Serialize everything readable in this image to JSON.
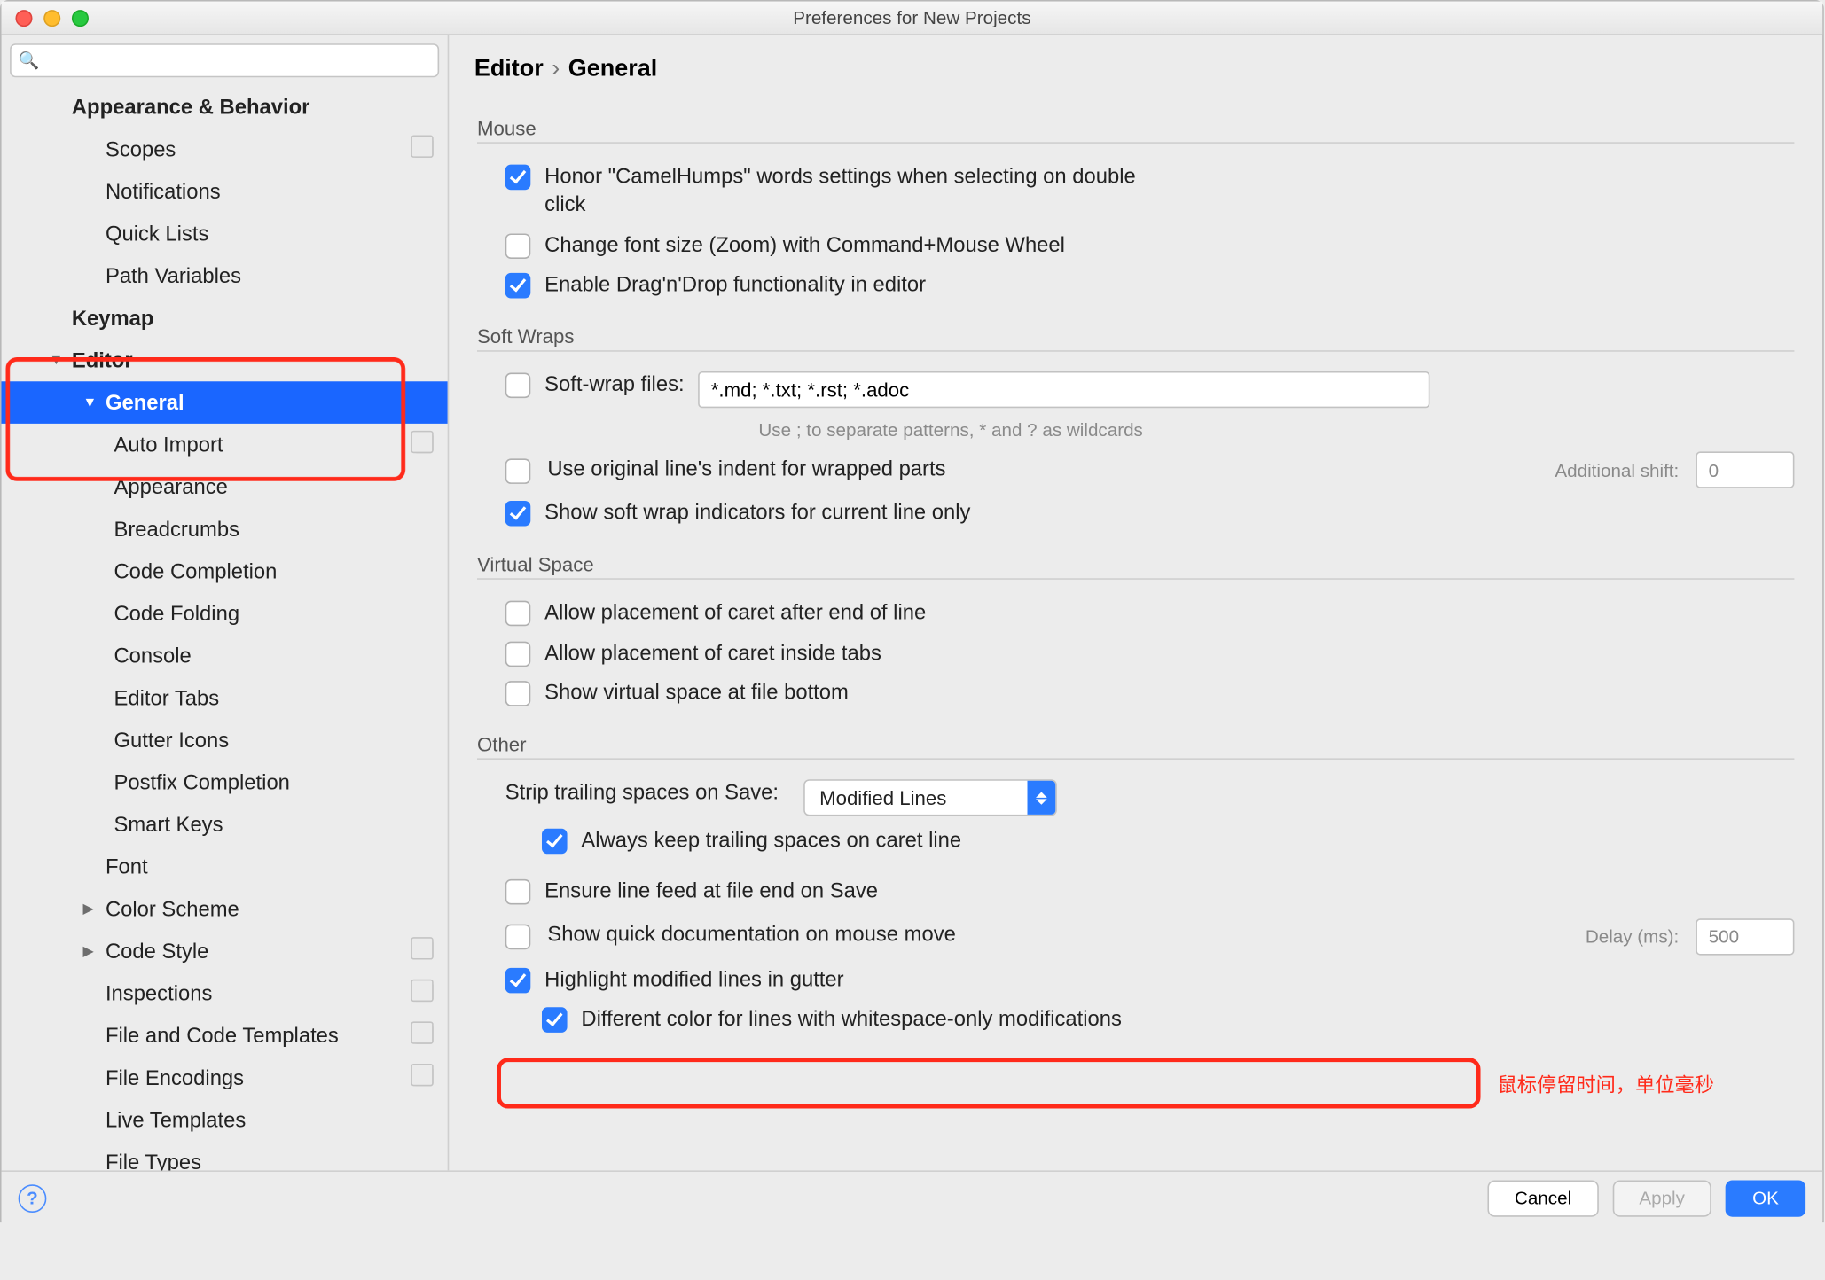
{
  "window_title": "Preferences for New Projects",
  "breadcrumb": {
    "root": "Editor",
    "leaf": "General"
  },
  "sidebar": {
    "items": [
      {
        "label": "Appearance & Behavior",
        "bold": true,
        "level": 1
      },
      {
        "label": "Scopes",
        "level": 2,
        "copy": true
      },
      {
        "label": "Notifications",
        "level": 2
      },
      {
        "label": "Quick Lists",
        "level": 2
      },
      {
        "label": "Path Variables",
        "level": 2
      },
      {
        "label": "Keymap",
        "bold": true,
        "level": 1
      },
      {
        "label": "Editor",
        "bold": true,
        "level": 1,
        "tri": "down"
      },
      {
        "label": "General",
        "bold": true,
        "level": 2,
        "tri": "down",
        "selected": true
      },
      {
        "label": "Auto Import",
        "level": 3,
        "copy": true
      },
      {
        "label": "Appearance",
        "level": 3
      },
      {
        "label": "Breadcrumbs",
        "level": 3
      },
      {
        "label": "Code Completion",
        "level": 3
      },
      {
        "label": "Code Folding",
        "level": 3
      },
      {
        "label": "Console",
        "level": 3
      },
      {
        "label": "Editor Tabs",
        "level": 3
      },
      {
        "label": "Gutter Icons",
        "level": 3
      },
      {
        "label": "Postfix Completion",
        "level": 3
      },
      {
        "label": "Smart Keys",
        "level": 3
      },
      {
        "label": "Font",
        "level": 2
      },
      {
        "label": "Color Scheme",
        "level": 2,
        "tri": "right"
      },
      {
        "label": "Code Style",
        "level": 2,
        "tri": "right",
        "copy": true
      },
      {
        "label": "Inspections",
        "level": 2,
        "copy": true
      },
      {
        "label": "File and Code Templates",
        "level": 2,
        "copy": true
      },
      {
        "label": "File Encodings",
        "level": 2,
        "copy": true
      },
      {
        "label": "Live Templates",
        "level": 2
      },
      {
        "label": "File Types",
        "level": 2
      }
    ]
  },
  "sections": {
    "mouse": {
      "title": "Mouse",
      "honor_camel": {
        "checked": true,
        "label": "Honor \"CamelHumps\" words settings when selecting on double click"
      },
      "zoom": {
        "checked": false,
        "label": "Change font size (Zoom) with Command+Mouse Wheel"
      },
      "dnd": {
        "checked": true,
        "label": "Enable Drag'n'Drop functionality in editor"
      }
    },
    "softwraps": {
      "title": "Soft Wraps",
      "softwrap_files": {
        "checked": false,
        "label": "Soft-wrap files:",
        "value": "*.md; *.txt; *.rst; *.adoc"
      },
      "hint": "Use ; to separate patterns, * and ? as wildcards",
      "indent": {
        "checked": false,
        "label": "Use original line's indent for wrapped parts",
        "extra_label": "Additional shift:",
        "extra_value": "0"
      },
      "indicators": {
        "checked": true,
        "label": "Show soft wrap indicators for current line only"
      }
    },
    "virtual": {
      "title": "Virtual Space",
      "after_eol": {
        "checked": false,
        "label": "Allow placement of caret after end of line"
      },
      "inside_tabs": {
        "checked": false,
        "label": "Allow placement of caret inside tabs"
      },
      "bottom": {
        "checked": false,
        "label": "Show virtual space at file bottom"
      }
    },
    "other": {
      "title": "Other",
      "strip_label": "Strip trailing spaces on Save:",
      "strip_value": "Modified Lines",
      "keep_trailing": {
        "checked": true,
        "label": "Always keep trailing spaces on caret line"
      },
      "ensure_lf": {
        "checked": false,
        "label": "Ensure line feed at file end on Save"
      },
      "quick_doc": {
        "checked": false,
        "label": "Show quick documentation on mouse move",
        "delay_label": "Delay (ms):",
        "delay_value": "500"
      },
      "highlight": {
        "checked": true,
        "label": "Highlight modified lines in gutter"
      },
      "diff_color": {
        "checked": true,
        "label": "Different color for lines with whitespace-only modifications"
      }
    }
  },
  "annotation": "鼠标停留时间，单位毫秒",
  "footer": {
    "cancel": "Cancel",
    "apply": "Apply",
    "ok": "OK"
  }
}
